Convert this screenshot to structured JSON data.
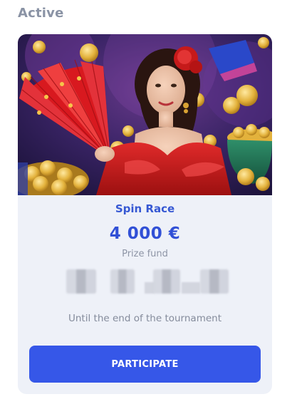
{
  "section": {
    "title": "Active"
  },
  "tournament": {
    "name": "Spin Race",
    "prize_amount": "4 000 €",
    "prize_label": "Prize fund",
    "countdown_caption": "Until the end of the tournament",
    "participate_label": "PARTICIPATE",
    "hero_image": "flamenco-dancer-with-red-fan-and-gold-coins"
  },
  "colors": {
    "accent": "#3657e8",
    "title_blue": "#3658d3",
    "card_bg": "#eef1f8",
    "muted_text": "#858c9c"
  }
}
